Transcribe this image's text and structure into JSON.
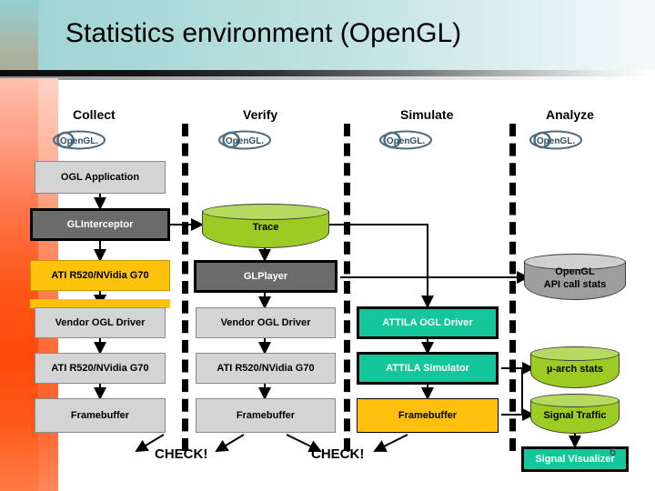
{
  "slide": {
    "title": "Statistics environment (OpenGL)",
    "page_number": "6",
    "logo_label": "OpenGL."
  },
  "columns": [
    {
      "id": "collect",
      "label": "Collect"
    },
    {
      "id": "verify",
      "label": "Verify"
    },
    {
      "id": "simulate",
      "label": "Simulate"
    },
    {
      "id": "analyze",
      "label": "Analyze"
    }
  ],
  "collect_column": {
    "app": "OGL Application",
    "interceptor": "GLInterceptor",
    "gpu_top": "ATI R520/NVidia G70",
    "driver": "Vendor OGL Driver",
    "gpu_bottom": "ATI R520/NVidia G70",
    "framebuffer": "Framebuffer"
  },
  "verify_column": {
    "trace": "Trace",
    "player": "GLPlayer",
    "driver": "Vendor OGL Driver",
    "gpu": "ATI R520/NVidia G70",
    "framebuffer": "Framebuffer",
    "check": "CHECK!"
  },
  "simulate_column": {
    "driver": "ATTILA OGL Driver",
    "simulator": "ATTILA Simulator",
    "framebuffer": "Framebuffer",
    "check": "CHECK!"
  },
  "analyze_column": {
    "api_stats_line1": "OpenGL",
    "api_stats_line2": "API call stats",
    "uarch_stats": "µ-arch stats",
    "signal_traffic": "Signal Traffic",
    "visualizer": "Signal Visualizer"
  },
  "colors": {
    "header_teal": "#9ed4d4",
    "left_orange": "#ff4a0a",
    "box_grey": "#d4d4d4",
    "box_dark": "#6b6b6b",
    "box_yellow": "#ffc20a",
    "box_teal": "#14c79a",
    "cyl_green": "#9acd32",
    "cyl_grey": "#9e9e9e"
  }
}
